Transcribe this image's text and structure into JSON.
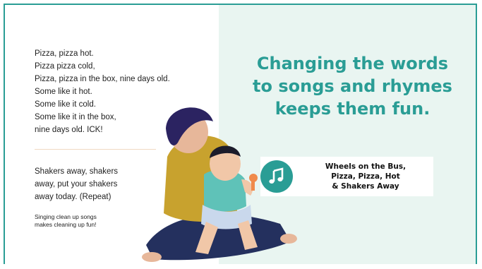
{
  "poem": {
    "lines": [
      "Pizza, pizza hot.",
      "Pizza pizza cold,",
      "Pizza, pizza in the box, nine days old.",
      "Some like it hot.",
      "Some like it cold.",
      "Some like it in the box,",
      "nine days old. ICK!"
    ]
  },
  "shakers": {
    "lines": [
      "Shakers away, shakers",
      "away, put your shakers",
      "away today. (Repeat)"
    ]
  },
  "note": {
    "lines": [
      "Singing clean up songs",
      "makes cleaning up fun!"
    ]
  },
  "headline": {
    "lines": [
      "Changing the words",
      "to songs and rhymes",
      "keeps them fun."
    ]
  },
  "songs": {
    "icon": "music-note-icon",
    "lines": [
      "Wheels on the Bus,",
      "Pizza, Pizza, Hot",
      "& Shakers Away"
    ]
  },
  "colors": {
    "accent": "#2a9d95",
    "panel": "#e9f5f1",
    "text": "#1f1f1f"
  }
}
